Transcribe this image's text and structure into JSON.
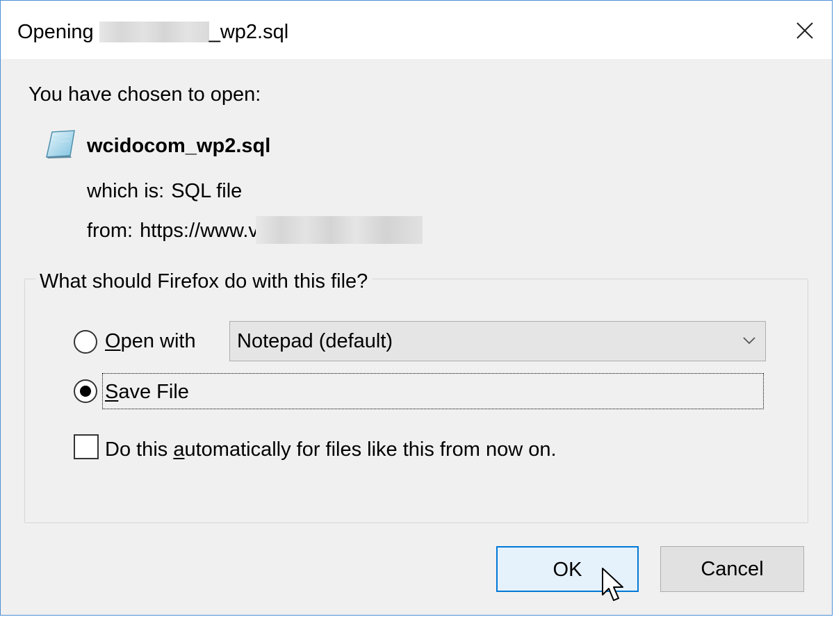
{
  "window": {
    "title_prefix": "Opening ",
    "title_suffix": "_wp2.sql",
    "close_label": "Close"
  },
  "intro": "You have chosen to open:",
  "file": {
    "icon": "document-icon",
    "name": "wcidocom_wp2.sql",
    "which_label": "which is:",
    "which_value": "SQL file",
    "from_label": "from:",
    "from_value": "https://www.v"
  },
  "action_group": {
    "legend": "What should Firefox do with this file?",
    "open_with": {
      "label_pre": "",
      "label_accel": "O",
      "label_post": "pen with",
      "selected": false,
      "app_value": "Notepad (default)"
    },
    "save_file": {
      "label_pre": "",
      "label_accel": "S",
      "label_post": "ave File",
      "selected": true
    },
    "auto": {
      "label_pre": "Do this ",
      "label_accel": "a",
      "label_post": "utomatically for files like this from now on.",
      "checked": false
    }
  },
  "buttons": {
    "ok": "OK",
    "cancel": "Cancel"
  },
  "colors": {
    "accent": "#0078d7",
    "dialog_bg": "#f0f0f0",
    "window_border": "#4a8fd6"
  }
}
